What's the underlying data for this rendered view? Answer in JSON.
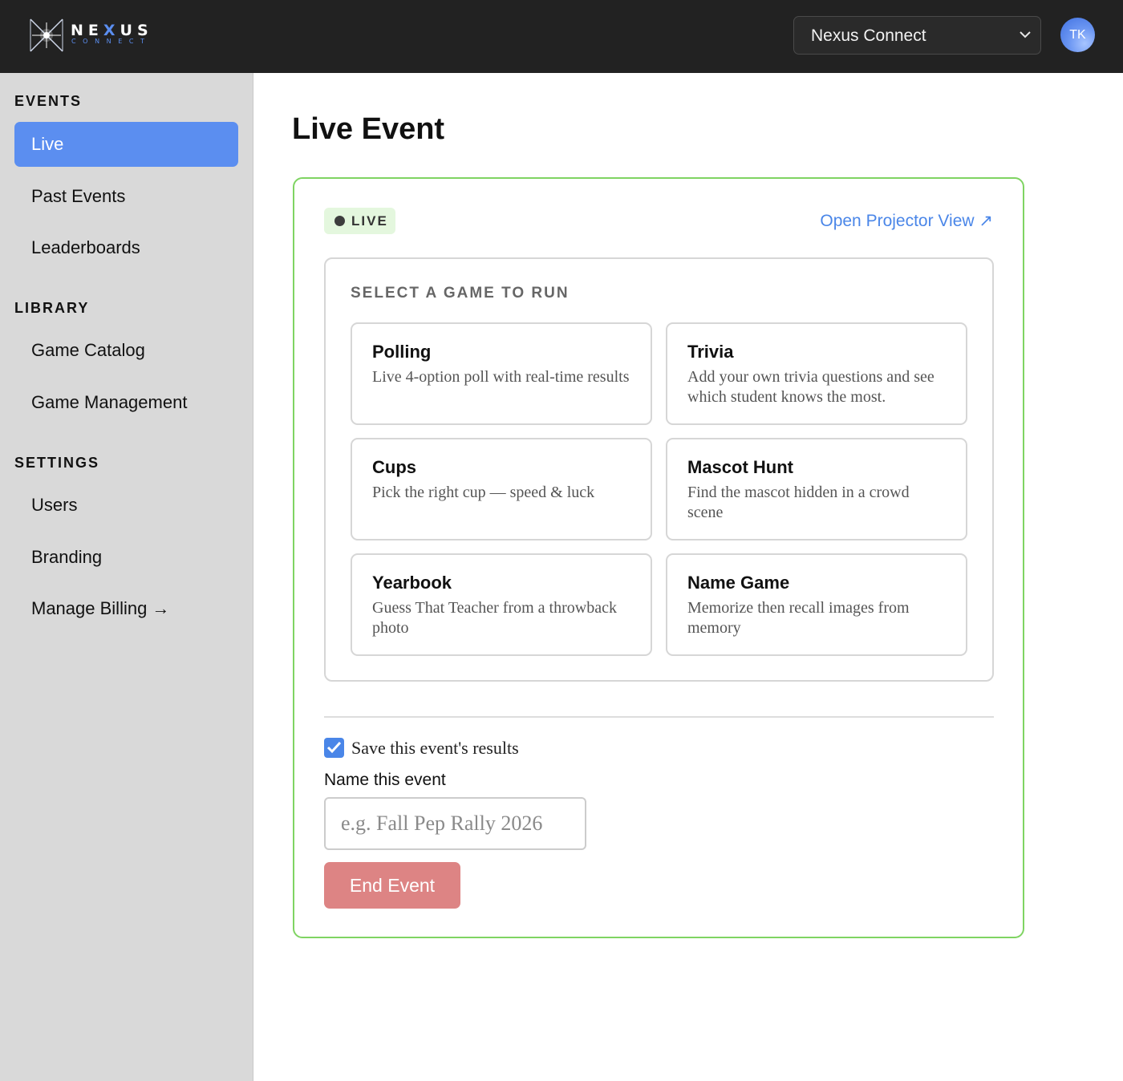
{
  "header": {
    "logo_word_left": "NE",
    "logo_word_x": "X",
    "logo_word_right": "US",
    "logo_sub": "CONNECT",
    "org_selector_value": "Nexus Connect",
    "avatar_initials": "TK"
  },
  "sidebar": {
    "sections": [
      {
        "title": "EVENTS",
        "items": [
          {
            "label": "Live",
            "active": true
          },
          {
            "label": "Past Events"
          },
          {
            "label": "Leaderboards"
          }
        ]
      },
      {
        "title": "LIBRARY",
        "items": [
          {
            "label": "Game Catalog"
          },
          {
            "label": "Game Management"
          }
        ]
      },
      {
        "title": "SETTINGS",
        "items": [
          {
            "label": "Users"
          },
          {
            "label": "Branding"
          },
          {
            "label": "Manage Billing →"
          }
        ]
      }
    ]
  },
  "main": {
    "title": "Live Event",
    "status_badge": "LIVE",
    "projector_link": "Open Projector View ↗",
    "game_panel_label": "SELECT A GAME TO RUN",
    "games": [
      {
        "title": "Polling",
        "description": "Live 4-option poll with real-time results"
      },
      {
        "title": "Trivia",
        "description": "Add your own trivia questions and see which student knows the most."
      },
      {
        "title": "Cups",
        "description": "Pick the right cup — speed & luck"
      },
      {
        "title": "Mascot Hunt",
        "description": "Find the mascot hidden in a crowd scene"
      },
      {
        "title": "Yearbook",
        "description": "Guess That Teacher from a throwback photo"
      },
      {
        "title": "Name Game",
        "description": "Memorize then recall images from memory"
      }
    ],
    "save_results_checked": true,
    "save_results_label": "Save this event's results",
    "event_name_label": "Name this event",
    "event_name_value": "",
    "event_name_placeholder": "e.g. Fall Pep Rally 2026",
    "end_button": "End Event"
  },
  "colors": {
    "accent": "#5b8ef0",
    "live_border": "#7fd462",
    "end_button": "#dd8484",
    "topbar": "#222222",
    "sidebar": "#d9d9d9"
  }
}
